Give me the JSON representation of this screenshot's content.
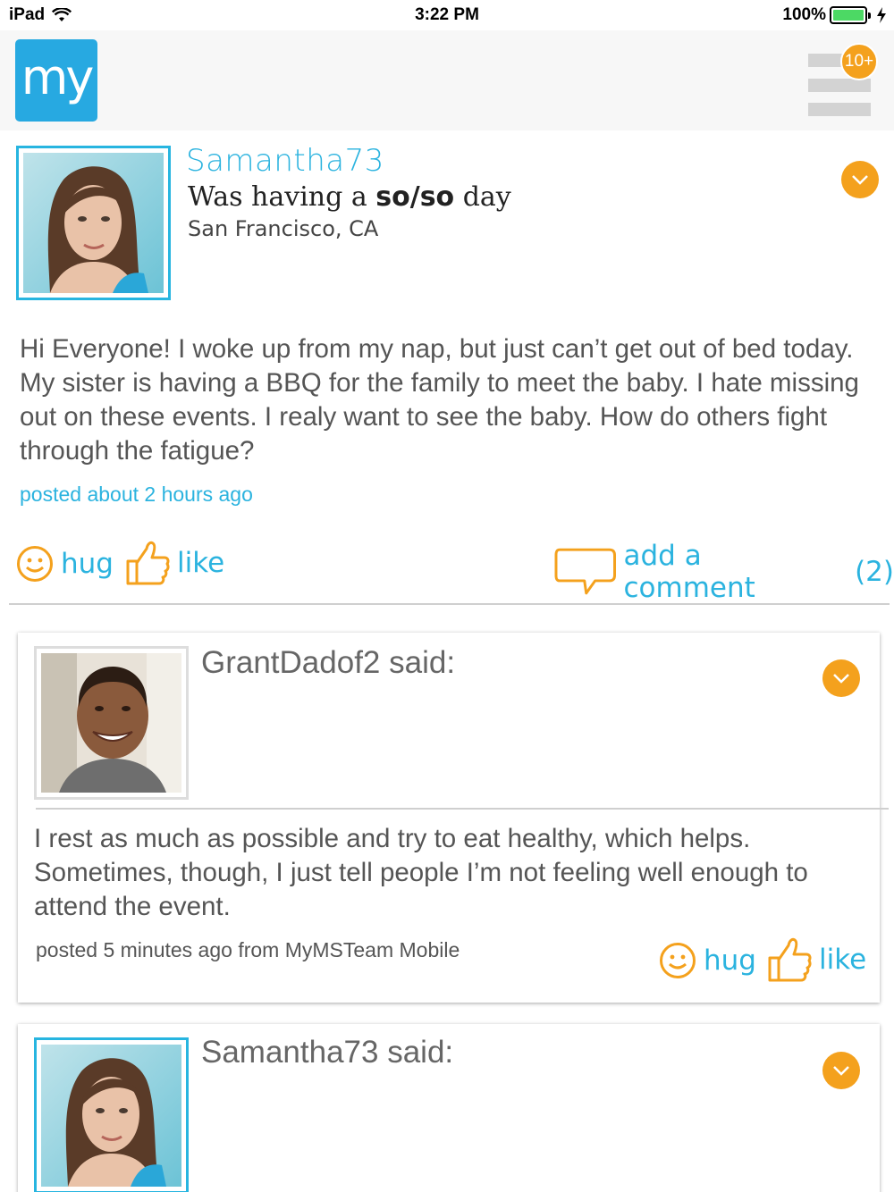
{
  "status_bar": {
    "device": "iPad",
    "time": "3:22 PM",
    "battery": "100%"
  },
  "header": {
    "logo": "my",
    "menu_icon": "hamburger-icon",
    "notification_badge": "10+"
  },
  "post": {
    "username": "Samantha73",
    "mood_prefix": "Was having a ",
    "mood": "so/so",
    "mood_suffix": " day",
    "location": "San Francisco, CA",
    "body": "Hi Everyone! I woke up from my nap, but just can’t get out of bed today.  My sister is having a BBQ for the family to meet the baby.  I hate missing out on these events.  I realy want to see the baby.  How do others fight through the fatigue?",
    "time": "posted about 2 hours ago",
    "hug_label": "hug",
    "like_label": "like",
    "comment_label": "add a comment",
    "comment_count": "(2)"
  },
  "comments": [
    {
      "author_said": "GrantDadof2 said:",
      "body": "I rest as much as possible and try to eat healthy, which helps. Sometimes, though, I just tell people I’m not feeling well enough to attend the event.",
      "meta": "posted 5 minutes ago from MyMSTeam Mobile",
      "hug_label": "hug",
      "like_label": "like"
    },
    {
      "author_said": "Samantha73 said:"
    }
  ],
  "colors": {
    "accent_blue": "#2bb3df",
    "accent_orange": "#f4a11d",
    "logo_blue": "#27a9e1"
  }
}
